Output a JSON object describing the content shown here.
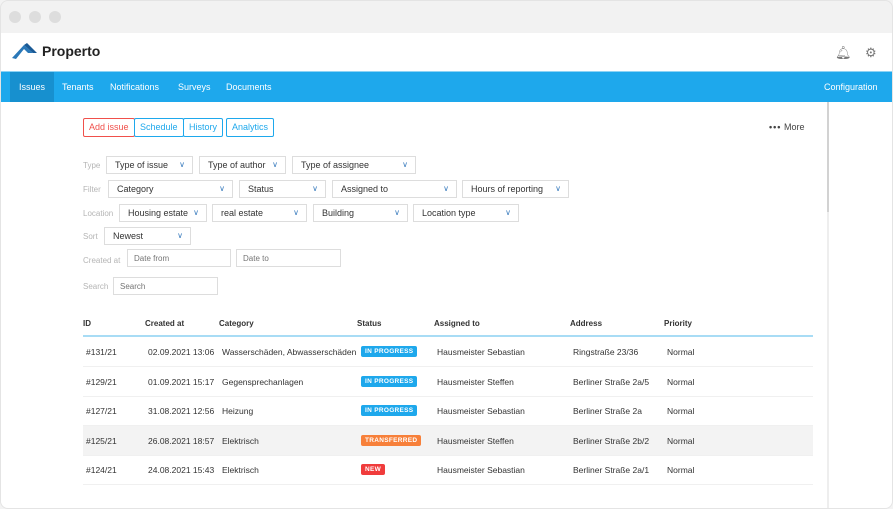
{
  "app": {
    "name": "Properto"
  },
  "nav": {
    "items": [
      "Issues",
      "Tenants",
      "Notifications",
      "Surveys",
      "Documents"
    ],
    "active": "Issues",
    "config": "Configuration"
  },
  "actions": {
    "add": "Add issue",
    "schedule": "Schedule",
    "history": "History",
    "analytics": "Analytics",
    "more": "More"
  },
  "filters": {
    "type_label": "Type",
    "type": [
      "Type of issue",
      "Type of author",
      "Type of assignee"
    ],
    "filter_label": "Filter",
    "filter": [
      "Category",
      "Status",
      "Assigned to",
      "Hours of reporting"
    ],
    "location_label": "Location",
    "location": [
      "Housing estate",
      "real estate",
      "Building",
      "Location type"
    ],
    "sort_label": "Sort",
    "sort": "Newest",
    "created_label": "Created at",
    "date_from": "Date from",
    "date_to": "Date to",
    "search_label": "Search",
    "search_placeholder": "Search"
  },
  "table": {
    "headers": [
      "ID",
      "Created at",
      "Category",
      "Status",
      "Assigned to",
      "Address",
      "Priority"
    ],
    "rows": [
      {
        "id": "#131/21",
        "created": "02.09.2021 13:06",
        "category": "Wasserschäden, Abwasserschäden",
        "status": "IN PROGRESS",
        "assigned": "Hausmeister Sebastian",
        "address": "Ringstraße 23/36",
        "priority": "Normal"
      },
      {
        "id": "#129/21",
        "created": "01.09.2021 15:17",
        "category": "Gegensprechanlagen",
        "status": "IN PROGRESS",
        "assigned": "Hausmeister Steffen",
        "address": "Berliner Straße 2a/5",
        "priority": "Normal"
      },
      {
        "id": "#127/21",
        "created": "31.08.2021 12:56",
        "category": "Heizung",
        "status": "IN PROGRESS",
        "assigned": "Hausmeister Sebastian",
        "address": "Berliner Straße 2a",
        "priority": "Normal"
      },
      {
        "id": "#125/21",
        "created": "26.08.2021 18:57",
        "category": "Elektrisch",
        "status": "TRANSFERRED",
        "assigned": "Hausmeister Steffen",
        "address": "Berliner Straße 2b/2",
        "priority": "Normal"
      },
      {
        "id": "#124/21",
        "created": "24.08.2021 15:43",
        "category": "Elektrisch",
        "status": "NEW",
        "assigned": "Hausmeister Sebastian",
        "address": "Berliner Straße 2a/1",
        "priority": "Normal"
      }
    ]
  },
  "colors": {
    "brand": "#1ea8ec",
    "in_progress": "#1ea8ec",
    "transferred": "#f7803a",
    "new": "#f03c3c"
  }
}
